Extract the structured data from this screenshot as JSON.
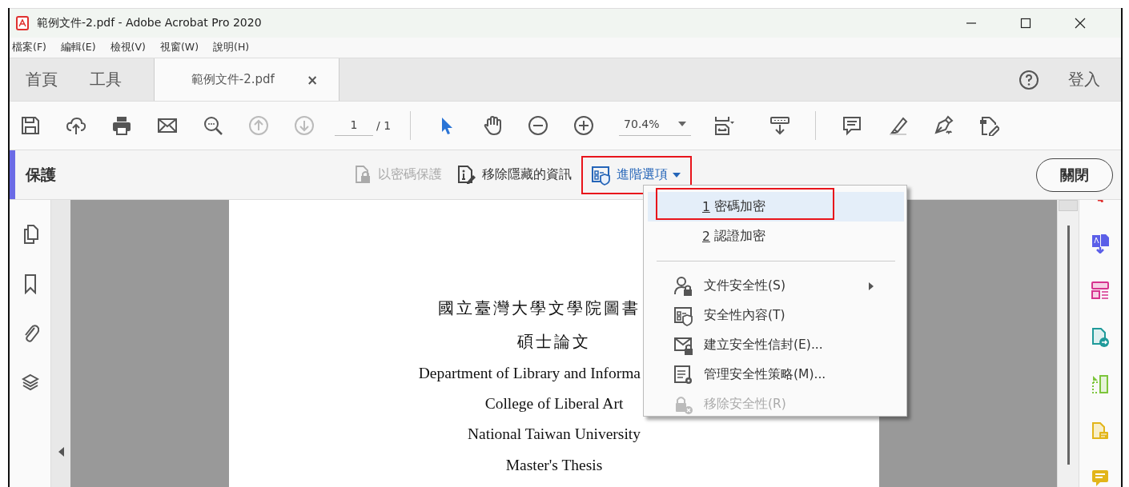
{
  "window": {
    "title": "範例文件-2.pdf - Adobe Acrobat Pro 2020"
  },
  "menu_bar": [
    "檔案(F)",
    "編輯(E)",
    "檢視(V)",
    "視窗(W)",
    "說明(H)"
  ],
  "tabs": [
    {
      "label": "首頁",
      "kind": "nav",
      "selected": false
    },
    {
      "label": "工具",
      "kind": "nav",
      "selected": false
    },
    {
      "label": "範例文件-2.pdf",
      "kind": "document",
      "selected": true,
      "close": "×"
    }
  ],
  "sign_in": "登入",
  "toolbar": {
    "previous_disabled": true,
    "next_disabled": true,
    "page_current": "1",
    "page_total": "/ 1",
    "select_active": true,
    "zoom": "70.4%"
  },
  "protect_bar": {
    "title": "保護",
    "tools": [
      {
        "label": "以密碼保護",
        "disabled": true,
        "outlined": false,
        "dropdown": false
      },
      {
        "label": "移除隱藏的資訊",
        "disabled": false,
        "outlined": false,
        "dropdown": false
      },
      {
        "label": "進階選項",
        "disabled": false,
        "outlined": true,
        "dropdown": true
      }
    ],
    "close": "關閉"
  },
  "dropdown": {
    "items": [
      {
        "kind": "numbered",
        "number": "1",
        "label": "密碼加密",
        "selected": true,
        "outlined": true
      },
      {
        "kind": "numbered",
        "number": "2",
        "label": "認證加密",
        "selected": false,
        "outlined": false
      },
      {
        "kind": "separator"
      },
      {
        "kind": "icon",
        "label": "文件安全性(S)",
        "disabled": false,
        "submenu": true
      },
      {
        "kind": "icon",
        "label": "安全性內容(T)",
        "disabled": false,
        "submenu": false
      },
      {
        "kind": "icon",
        "label": "建立安全性信封(E)...",
        "disabled": false,
        "submenu": false
      },
      {
        "kind": "icon",
        "label": "管理安全性策略(M)...",
        "disabled": false,
        "submenu": false
      },
      {
        "kind": "icon",
        "label": "移除安全性(R)",
        "disabled": true,
        "submenu": false
      }
    ]
  },
  "document": {
    "lines": [
      {
        "text": "國立臺灣大學文學院圖書",
        "kind": "heading"
      },
      {
        "text": "碩士論文",
        "kind": "heading"
      },
      {
        "text": "Department of Library and Informa",
        "kind": "body"
      },
      {
        "text": "College of Liberal Art",
        "kind": "body"
      },
      {
        "text": "National Taiwan University",
        "kind": "body"
      },
      {
        "text": "Master's Thesis",
        "kind": "body"
      }
    ]
  }
}
